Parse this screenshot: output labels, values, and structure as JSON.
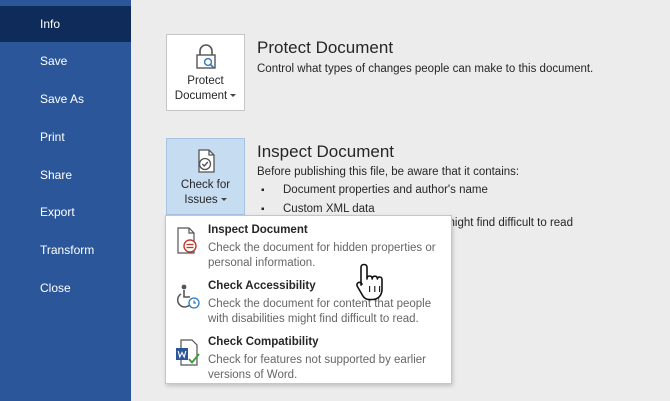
{
  "sidebar": {
    "items": [
      {
        "label": "Info",
        "active": true
      },
      {
        "label": "Save"
      },
      {
        "label": "Save As"
      },
      {
        "label": "Print"
      },
      {
        "label": "Share"
      },
      {
        "label": "Export"
      },
      {
        "label": "Transform"
      },
      {
        "label": "Close"
      }
    ]
  },
  "protect": {
    "button_line1": "Protect",
    "button_line2": "Document",
    "title": "Protect Document",
    "description": "Control what types of changes people can make to this document.",
    "icon": "lock-search-icon"
  },
  "inspect": {
    "button_line1": "Check for",
    "button_line2": "Issues",
    "title": "Inspect Document",
    "description": "Before publishing this file, be aware that it contains:",
    "bullets": [
      "Document properties and author's name",
      "Custom XML data"
    ],
    "bullet_tail": "es might find difficult to read",
    "icon": "check-document-icon"
  },
  "dropdown": {
    "items": [
      {
        "title": "Inspect Document",
        "desc": "Check the document for hidden properties or personal information.",
        "icon": "inspect-document-icon"
      },
      {
        "title": "Check Accessibility",
        "desc": "Check the document for content that people with disabilities might find difficult to read.",
        "icon": "accessibility-icon"
      },
      {
        "title": "Check Compatibility",
        "desc": "Check for features not supported by earlier versions of Word.",
        "icon": "word-compatibility-icon"
      }
    ]
  },
  "colors": {
    "sidebar_bg": "#2b579a",
    "sidebar_active": "#0f2b5a",
    "main_bg": "#ececec",
    "selected_button": "#c6dcf1"
  }
}
